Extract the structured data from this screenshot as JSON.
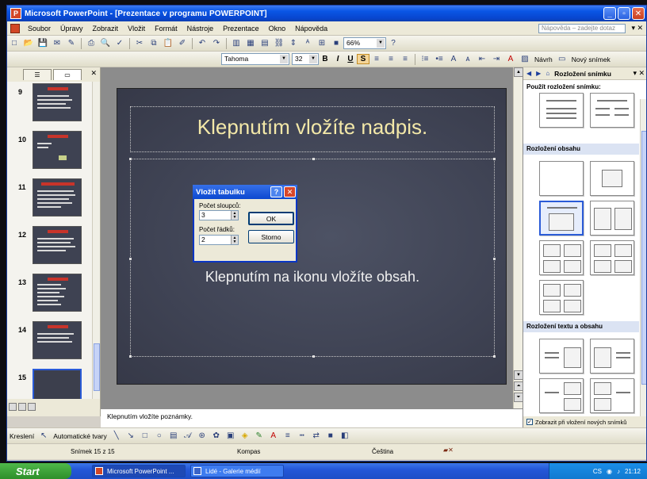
{
  "window": {
    "title": "Microsoft PowerPoint - [Prezentace v programu POWERPOINT]"
  },
  "menu": {
    "items": [
      "Soubor",
      "Úpravy",
      "Zobrazit",
      "Vložit",
      "Formát",
      "Nástroje",
      "Prezentace",
      "Okno",
      "Nápověda"
    ],
    "help_placeholder": "Nápověda – zadejte dotaz"
  },
  "toolbar": {
    "zoom": "66%",
    "font": "Tahoma",
    "font_size": "32",
    "design_label": "Návrh",
    "new_slide_label": "Nový snímek"
  },
  "slides_pane": {
    "thumbnails": [
      {
        "number": "9"
      },
      {
        "number": "10"
      },
      {
        "number": "11"
      },
      {
        "number": "12"
      },
      {
        "number": "13"
      },
      {
        "number": "14"
      },
      {
        "number": "15"
      }
    ]
  },
  "slide": {
    "title_placeholder": "Klepnutím vložíte nadpis.",
    "content_placeholder": "Klepnutím na ikonu vložíte obsah."
  },
  "dialog": {
    "title": "Vložit tabulku",
    "columns_label": "Počet sloupců:",
    "columns_value": "3",
    "rows_label": "Počet řádků:",
    "rows_value": "2",
    "ok_label": "OK",
    "cancel_label": "Storno"
  },
  "notes": {
    "placeholder": "Klepnutím vložíte poznámky."
  },
  "task_pane": {
    "title": "Rozložení snímku",
    "apply_label": "Použít rozložení snímku:",
    "section_content": "Rozložení obsahu",
    "section_text_content": "Rozložení textu a obsahu",
    "show_on_insert": "Zobrazit při vložení nových snímků"
  },
  "drawing_toolbar": {
    "draw_label": "Kreslení",
    "autoshapes_label": "Automatické tvary"
  },
  "status": {
    "slide_info": "Snímek 15 z 15",
    "design": "Kompas",
    "language": "Čeština"
  },
  "taskbar": {
    "start_label": "Start",
    "tasks": [
      "Microsoft PowerPoint ...",
      "Lidé - Galerie médií"
    ],
    "lang": "CS",
    "clock": "21:12"
  },
  "colors": {
    "slide_background": "#3f4354",
    "title_text": "#f3e8a8",
    "titlebar": "#0a56e5"
  }
}
